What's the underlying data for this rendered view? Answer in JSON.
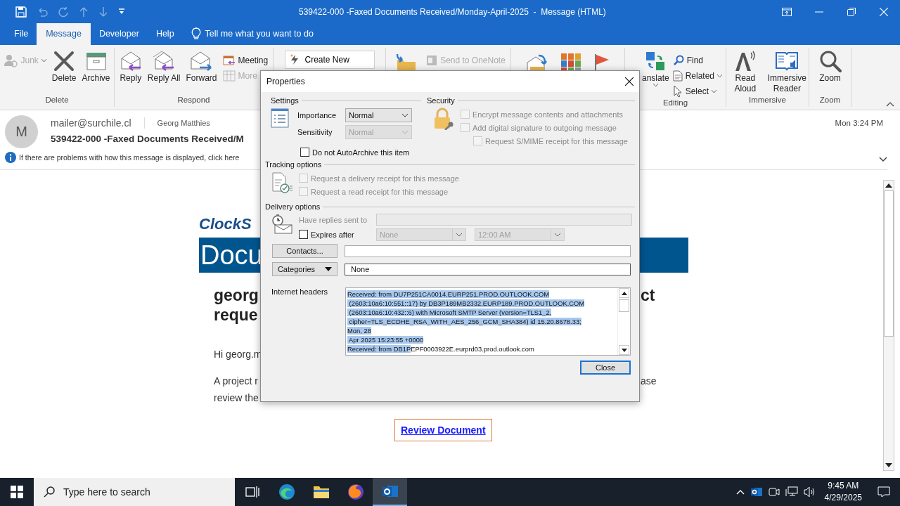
{
  "window": {
    "title": "539422-000 -Faxed Documents Received/Monday-April-2025  -  Message (HTML)"
  },
  "quick_access": [
    {
      "disabled": false
    },
    {
      "disabled": true
    },
    {
      "disabled": true
    },
    {
      "disabled": true
    },
    {
      "disabled": true
    },
    {
      "disabled": false
    }
  ],
  "menu_tabs": [
    {
      "label": "File",
      "selected": false
    },
    {
      "label": "Message",
      "selected": true
    },
    {
      "label": "Developer",
      "selected": false
    },
    {
      "label": "Help",
      "selected": false
    }
  ],
  "tell_me": {
    "placeholder": "Tell me what you want to do"
  },
  "ribbon": [
    {
      "label": "Delete",
      "items": [
        {
          "kind": "small-menu",
          "label": "Junk",
          "disabled": true
        },
        {
          "kind": "large",
          "label": "Delete",
          "disabled": false
        },
        {
          "kind": "large",
          "label": "Archive",
          "disabled": false
        }
      ]
    },
    {
      "label": "Respond",
      "items": [
        {
          "kind": "large",
          "label": "Reply",
          "disabled": false
        },
        {
          "kind": "large",
          "label": "Reply All",
          "disabled": false
        },
        {
          "kind": "large",
          "label": "Forward",
          "disabled": false
        },
        {
          "kind": "small",
          "label": "Meeting",
          "disabled": false
        },
        {
          "kind": "small",
          "label": "More",
          "disabled": true
        }
      ]
    },
    {
      "items": [
        {
          "kind": "gallery",
          "label": "Create New",
          "disabled": false
        }
      ]
    },
    {
      "items": [
        {
          "kind": "icon",
          "disabled": false
        },
        {
          "kind": "small",
          "label": "Send to OneNote",
          "disabled": true
        }
      ]
    },
    {
      "items": [
        {
          "kind": "icon",
          "disabled": false
        },
        {
          "kind": "icon",
          "disabled": false
        },
        {
          "kind": "icon",
          "disabled": false
        }
      ]
    },
    {
      "label": "Editing",
      "items": [
        {
          "kind": "large-menu",
          "label": "anslate",
          "disabled": false
        },
        {
          "kind": "small",
          "label": "Find",
          "disabled": false
        },
        {
          "kind": "small-menu",
          "label": "Related",
          "disabled": false
        },
        {
          "kind": "small-menu",
          "label": "Select",
          "disabled": false
        }
      ]
    },
    {
      "label": "Immersive",
      "items": [
        {
          "kind": "large",
          "label": "Read Aloud",
          "disabled": false
        },
        {
          "kind": "large",
          "label": "Immersive Reader",
          "disabled": false
        }
      ]
    },
    {
      "label": "Zoom",
      "items": [
        {
          "kind": "large",
          "label": "Zoom",
          "disabled": false
        }
      ]
    }
  ],
  "message": {
    "avatar": "M",
    "from": "mailer@surchile.cl",
    "to": "Georg Matthies",
    "subject": "539422-000 -Faxed Documents Received/M",
    "info": "If there are problems with how this message is displayed, click here",
    "time": "Mon 3:24 PM"
  },
  "email": {
    "logo": "ClockS",
    "banner": "Docu",
    "heading": [
      {
        "left": "georg",
        "right": "ct"
      },
      {
        "left": "reque"
      }
    ],
    "greeting": "Hi georg.m",
    "paragraph": [
      {
        "left": "A project r",
        "right": "ase"
      },
      {
        "left": "review the"
      }
    ],
    "button": "Review Document"
  },
  "dialog": {
    "title": "Properties",
    "settings": {
      "title": "Settings",
      "fields": [
        {
          "label": "Importance",
          "value": "Normal",
          "disabled": false
        },
        {
          "label": "Sensitivity",
          "value": "Normal",
          "disabled": true
        }
      ],
      "autoarchive": {
        "label": "Do not AutoArchive this item",
        "checked": false,
        "disabled": false
      }
    },
    "security": {
      "title": "Security",
      "options": [
        {
          "label": "Encrypt message contents and attachments",
          "checked": false,
          "disabled": true
        },
        {
          "label": "Add digital signature to outgoing message",
          "checked": false,
          "disabled": true,
          "children": [
            {
              "label": "Request S/MIME receipt for this message",
              "checked": false,
              "disabled": true
            }
          ]
        }
      ]
    },
    "tracking": {
      "title": "Tracking options",
      "options": [
        {
          "label": "Request a delivery receipt for this message",
          "checked": false,
          "disabled": true
        },
        {
          "label": "Request a read receipt for this message",
          "checked": false,
          "disabled": true
        }
      ]
    },
    "delivery": {
      "title": "Delivery options",
      "replies": {
        "label": "Have replies sent to",
        "disabled": true
      },
      "expires": {
        "label": "Expires after",
        "checked": false,
        "disabled": false,
        "date": "None",
        "time": "12:00 AM",
        "fields_disabled": true
      }
    },
    "contacts": {
      "label": "Contacts..."
    },
    "categories": {
      "label": "Categories",
      "value": "None"
    },
    "headers": {
      "label": "Internet headers",
      "lines": [
        [
          {
            "text": "Received: from DU7P251CA0014.EURP251.PROD.OUTLOOK.COM",
            "selected": true
          }
        ],
        [
          {
            "text": " (2603:10a6:10:551::17) by DB3P189MB2332.EURP189.PROD.OUTLOOK.COM",
            "selected": true
          }
        ],
        [
          {
            "text": " (2603:10a6:10:432::6) with Microsoft SMTP Server (version=TLS1_2,",
            "selected": true
          }
        ],
        [
          {
            "text": " cipher=TLS_ECDHE_RSA_WITH_AES_256_GCM_SHA384) id 15.20.8678.33;",
            "selected": true
          }
        ],
        [
          {
            "text": "Mon, 28",
            "selected": true
          }
        ],
        [
          {
            "text": " Apr 2025 15:23:55 +0000",
            "selected": true
          }
        ],
        [
          {
            "text": "Received: from DB1P",
            "selected": true
          },
          {
            "text": "EPF0003922E.eurprd03.prod.outlook.com",
            "selected": false
          }
        ]
      ]
    },
    "close": "Close"
  },
  "taskbar": {
    "search": {
      "placeholder": "Type here to search"
    },
    "apps": [
      {
        "selected": false
      },
      {
        "selected": false
      },
      {
        "selected": false
      },
      {
        "selected": false
      },
      {
        "selected": true
      }
    ],
    "time": "9:45 AM",
    "date": "4/29/2025"
  }
}
